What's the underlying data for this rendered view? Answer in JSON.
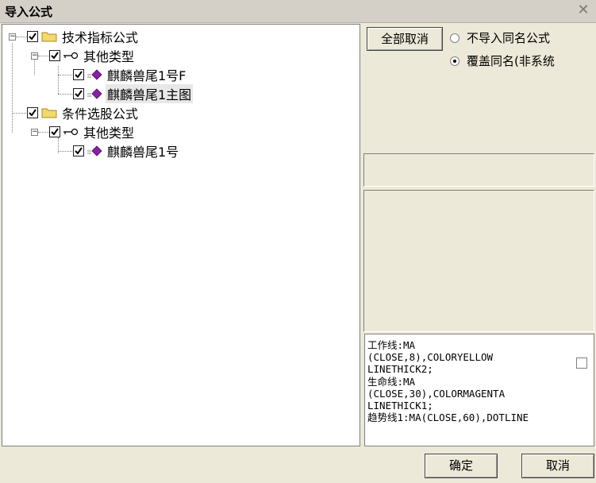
{
  "window": {
    "title": "导入公式",
    "close_glyph": "✕"
  },
  "tree": {
    "nodes": [
      {
        "label": "技术指标公式",
        "type": "folder",
        "checked": true
      },
      {
        "label": "其他类型",
        "type": "group",
        "checked": true
      },
      {
        "label": "麒麟兽尾1号F",
        "type": "formula",
        "checked": true
      },
      {
        "label": "麒麟兽尾1主图",
        "type": "formula",
        "checked": true,
        "selected": true
      },
      {
        "label": "条件选股公式",
        "type": "folder",
        "checked": true
      },
      {
        "label": "其他类型",
        "type": "group",
        "checked": true
      },
      {
        "label": "麒麟兽尾1号",
        "type": "formula",
        "checked": true
      }
    ]
  },
  "options": {
    "cancel_all_label": "全部取消",
    "radio_skip_label": "不导入同名公式",
    "radio_overwrite_label": "覆盖同名(非系统",
    "selected": "overwrite"
  },
  "formula_text": [
    "工作线:MA",
    "(CLOSE,8),COLORYELLOW",
    "LINETHICK2;",
    "生命线:MA",
    "(CLOSE,30),COLORMAGENTA",
    "LINETHICK1;",
    "趋势线1:MA(CLOSE,60),DOTLINE"
  ],
  "footer": {
    "ok_label": "确定",
    "cancel_label": "取消"
  },
  "icons": {
    "folder": "folder-icon",
    "group": "key-icon",
    "formula": "purple-gem-icon",
    "checkbox": "checkmark-icon"
  },
  "colors": {
    "gem": "#8b1fa8",
    "folder": "#f3d86b",
    "window_bg": "#ece9d8"
  }
}
